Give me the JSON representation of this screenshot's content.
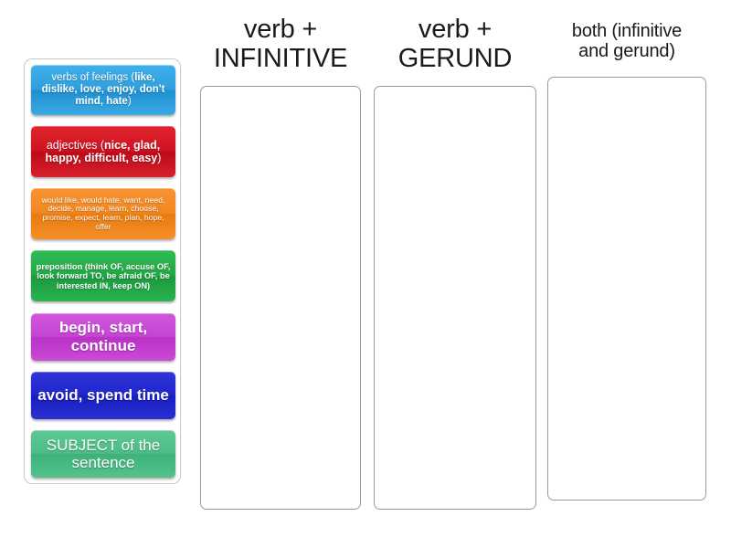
{
  "activity": {
    "type": "drag-and-drop-sorting",
    "title": "verb + infinitive / verb + gerund sorting activity"
  },
  "source_panel": {
    "name": "draggable category cards",
    "cards": [
      {
        "id": "verbs-of-feelings",
        "lead": "verbs of feelings (",
        "bold": "like, dislike, love, enjoy, don't mind, hate",
        "tail": ")",
        "full_text": "verbs of feelings (like, dislike, love, enjoy, don't mind, hate)",
        "color": "#2f9fdd",
        "color_name": "blue"
      },
      {
        "id": "adjectives",
        "lead": "adjectives (",
        "bold": "nice, glad, happy, difficult, easy",
        "tail": ")",
        "full_text": "adjectives (nice, glad, happy, difficult, easy)",
        "color": "#cf1220",
        "color_name": "red"
      },
      {
        "id": "would-like-group",
        "lead": "",
        "bold": "",
        "tail": "",
        "full_text": "would like, would hate, want, need, decide, manage, learn, choose, promise, expect, learn, plan, hope, offer",
        "color": "#f2871f",
        "color_name": "orange"
      },
      {
        "id": "preposition",
        "lead": "",
        "bold": "",
        "tail": "",
        "full_text": "preposition (think OF, accuse OF, look forward TO, be afraid OF, be interested IN, keep ON)",
        "color": "#23a845",
        "color_name": "green"
      },
      {
        "id": "begin-start-continue",
        "lead": "",
        "bold": "",
        "tail": "",
        "full_text": "begin, start, continue",
        "color": "#c544d2",
        "color_name": "magenta"
      },
      {
        "id": "avoid-spend-time",
        "lead": "",
        "bold": "",
        "tail": "",
        "full_text": "avoid, spend time",
        "color": "#2026cc",
        "color_name": "dark blue"
      },
      {
        "id": "subject-of-sentence",
        "lead": "",
        "bold": "",
        "tail": "",
        "full_text": "SUBJECT of the sentence",
        "color": "#4cbd87",
        "color_name": "sea green"
      }
    ]
  },
  "columns": [
    {
      "id": "infinitive",
      "heading_line1": "verb +",
      "heading_line2": "INFINITIVE",
      "dropped_items": []
    },
    {
      "id": "gerund",
      "heading_line1": "verb +",
      "heading_line2": "GERUND",
      "dropped_items": []
    },
    {
      "id": "both",
      "heading_line1": "both (infinitive",
      "heading_line2": "and gerund)",
      "dropped_items": []
    }
  ]
}
